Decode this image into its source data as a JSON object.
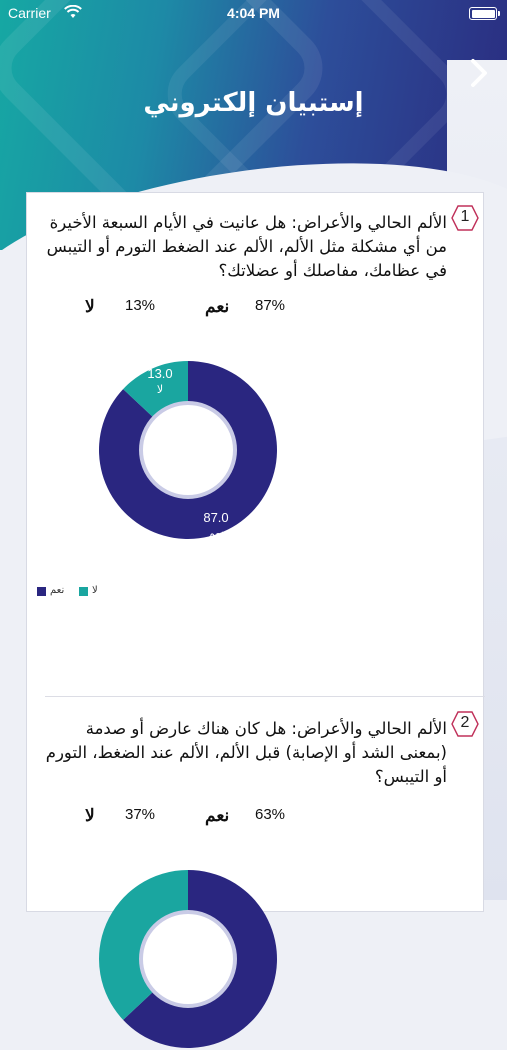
{
  "status_bar": {
    "carrier": "Carrier",
    "time": "4:04 PM"
  },
  "header": {
    "title": "إستبيان إلكتروني"
  },
  "colors": {
    "yes": "#2a2680",
    "no": "#1aa6a0"
  },
  "questions": [
    {
      "number": "1",
      "text": "الألم الحالي والأعراض: هل عانيت في الأيام السبعة الأخيرة من أي مشكلة مثل الألم، الألم عند الضغط التورم أو التيبس في عظامك، مفاصلك أو عضلاتك؟",
      "no_label": "لا",
      "no_pct": "13%",
      "yes_label": "نعم",
      "yes_pct": "87%",
      "chart_data": {
        "type": "pie",
        "categories": [
          "نعم",
          "لا"
        ],
        "values": [
          87.0,
          13.0
        ],
        "value_labels": [
          "87.0",
          "13.0"
        ]
      },
      "legend": {
        "yes": "نعم",
        "no": "لا"
      }
    },
    {
      "number": "2",
      "text": "الألم الحالي والأعراض: هل كان هناك عارض أو صدمة (بمعنى الشد أو الإصابة) قبل الألم، الألم عند الضغط، التورم أو التيبس؟",
      "no_label": "لا",
      "no_pct": "37%",
      "yes_label": "نعم",
      "yes_pct": "63%",
      "chart_data": {
        "type": "pie",
        "categories": [
          "نعم",
          "لا"
        ],
        "values": [
          63.0,
          37.0
        ]
      }
    }
  ]
}
